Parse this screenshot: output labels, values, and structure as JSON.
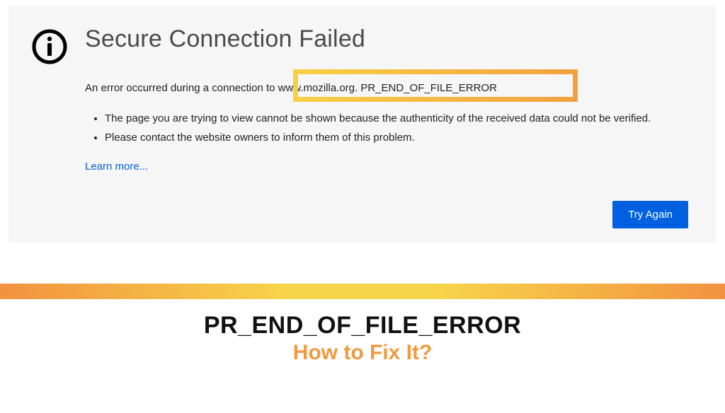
{
  "error": {
    "title": "Secure Connection Failed",
    "subtitle": "An error occurred during a connection to www.mozilla.org. PR_END_OF_FILE_ERROR",
    "bullets": [
      "The page you are trying to view cannot be shown because the authenticity of the received data could not be verified.",
      "Please contact the website owners to inform them of this problem."
    ],
    "learn_more": "Learn more...",
    "try_again": "Try Again"
  },
  "caption": {
    "main": "PR_END_OF_FILE_ERROR",
    "sub": "How to Fix It?"
  }
}
